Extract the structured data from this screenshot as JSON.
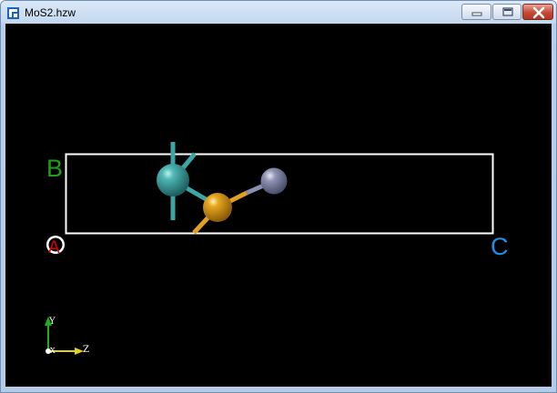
{
  "window": {
    "title": "MoS2.hzw",
    "icon": "app-icon"
  },
  "controls": {
    "minimize": "minimize-icon",
    "maximize": "maximize-icon",
    "close": "close-icon"
  },
  "viewer": {
    "background": "#000000",
    "cell_outline_color": "#ffffff",
    "lattice_labels": {
      "a": "A",
      "b": "B",
      "c": "C"
    },
    "lattice_colors": {
      "a": "#e00000",
      "b": "#1aa01a",
      "c": "#1e8fe6"
    },
    "atoms": [
      {
        "name": "mo-atom",
        "color": "#3aa6a6"
      },
      {
        "name": "s-atom",
        "color": "#e0a020"
      },
      {
        "name": "grey-atom",
        "color": "#8a8fb0"
      }
    ],
    "axis_triad": {
      "y_label": "Y",
      "x_label": "X",
      "z_label": "Z",
      "y_color": "#1fb01f",
      "z_color": "#e0d020"
    }
  }
}
